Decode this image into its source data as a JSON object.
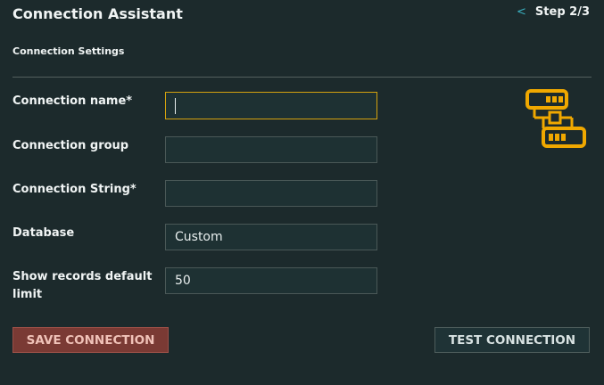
{
  "header": {
    "title": "Connection Assistant",
    "back_glyph": "<",
    "step": "Step 2/3"
  },
  "section": {
    "title": "Connection Settings"
  },
  "form": {
    "connection_name": {
      "label": "Connection name*",
      "value": ""
    },
    "connection_group": {
      "label": "Connection group",
      "value": ""
    },
    "connection_string": {
      "label": "Connection String*",
      "value": ""
    },
    "database": {
      "label": "Database",
      "value": "Custom"
    },
    "records_limit": {
      "label": "Show records default limit",
      "value": "50"
    }
  },
  "buttons": {
    "save": "SAVE CONNECTION",
    "test": "TEST CONNECTION"
  },
  "icons": {
    "connection": "database-connection-icon"
  },
  "colors": {
    "background": "#1c2a2c",
    "accent": "#f0a800",
    "focus_border": "#d4a20e",
    "save_button": "#7a3a34",
    "back_link": "#3ab0c0"
  }
}
